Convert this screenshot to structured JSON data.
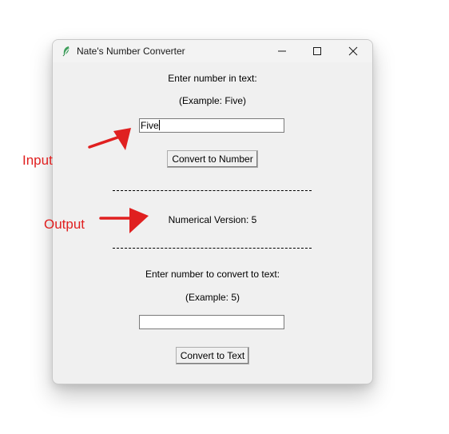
{
  "window": {
    "title": "Nate's Number Converter",
    "controls": {
      "minimize_icon": "minimize-icon",
      "maximize_icon": "maximize-icon",
      "close_icon": "close-icon"
    }
  },
  "text_to_number": {
    "prompt": "Enter number in text:",
    "example": "(Example: Five)",
    "input_value": "Five",
    "button_label": "Convert to Number"
  },
  "separator": "----------------------------------------",
  "output": {
    "result": "Numerical Version: 5"
  },
  "number_to_text": {
    "prompt": "Enter number to convert to text:",
    "example": "(Example: 5)",
    "input_value": "",
    "button_label": "Convert to Text"
  },
  "annotations": {
    "input_label": "Input",
    "output_label": "Output",
    "color": "#e02020"
  }
}
